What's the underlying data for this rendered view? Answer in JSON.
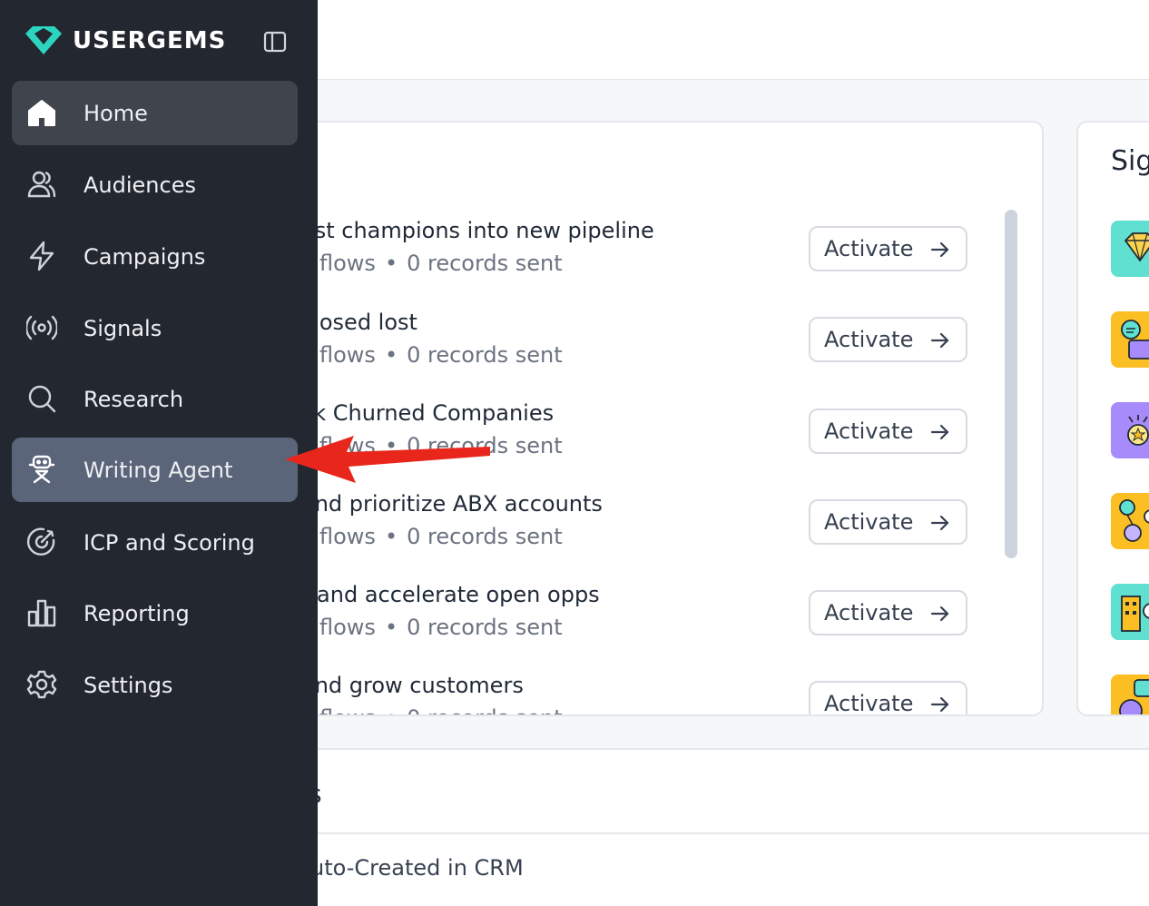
{
  "brand": {
    "name": "USERGEMS",
    "accent": "#2dd4bf"
  },
  "sidebar": {
    "collapse_icon": "sidebar-toggle-icon",
    "items": [
      {
        "label": "Home",
        "icon": "home-icon",
        "state": "active"
      },
      {
        "label": "Audiences",
        "icon": "users-icon",
        "state": "normal"
      },
      {
        "label": "Campaigns",
        "icon": "lightning-icon",
        "state": "normal"
      },
      {
        "label": "Signals",
        "icon": "broadcast-icon",
        "state": "normal"
      },
      {
        "label": "Research",
        "icon": "search-icon",
        "state": "normal"
      },
      {
        "label": "Writing Agent",
        "icon": "robot-icon",
        "state": "highlighted"
      },
      {
        "label": "ICP and Scoring",
        "icon": "target-icon",
        "state": "normal"
      },
      {
        "label": "Reporting",
        "icon": "bar-chart-icon",
        "state": "normal"
      },
      {
        "label": "Settings",
        "icon": "gear-icon",
        "state": "normal"
      }
    ]
  },
  "plays": {
    "button_label": "Activate",
    "items": [
      {
        "title": "ast champions into new pipeline",
        "flows": "flows",
        "separator": "•",
        "records": "0 records sent"
      },
      {
        "title": " closed lost",
        "flows": "flows",
        "separator": "•",
        "records": "0 records sent"
      },
      {
        "title": "ck Churned Companies",
        "flows": "flows",
        "separator": "•",
        "records": "0 records sent"
      },
      {
        "title": " and prioritize ABX accounts",
        "flows": "flows",
        "separator": "•",
        "records": "0 records sent"
      },
      {
        "title": "t and accelerate open opps",
        "flows": "flows",
        "separator": "•",
        "records": "0 records sent"
      },
      {
        "title": " and grow customers",
        "flows": "flows",
        "separator": "•",
        "records": "0 records sent"
      }
    ]
  },
  "signals_card": {
    "title": "Sig",
    "thumbs": [
      "diamond-thumb",
      "chat-thumb",
      "badge-thumb",
      "people-thumb",
      "building-thumb",
      "message-thumb"
    ]
  },
  "bottom": {
    "heading": "s",
    "row": "uto-Created in CRM"
  },
  "colors": {
    "sidebar_bg": "#23272f",
    "active_item": "#3f444d",
    "highlight_item": "#5b6579",
    "annotation": "#e8261b"
  }
}
